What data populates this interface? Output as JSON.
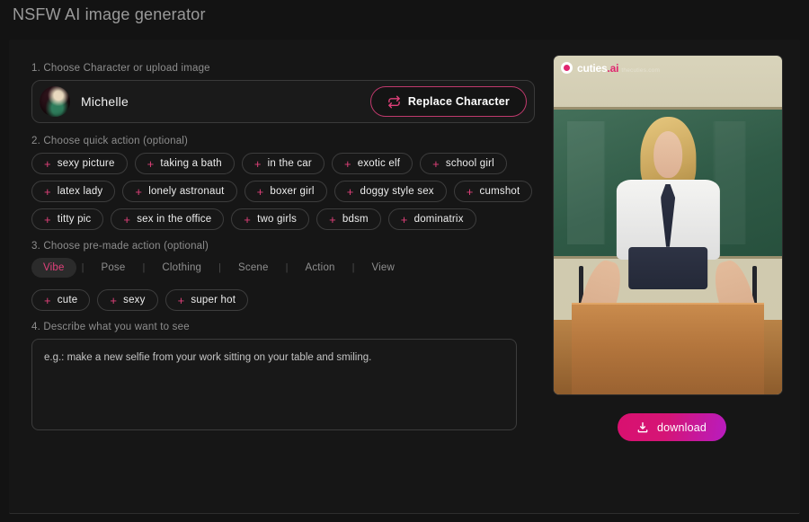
{
  "header": {
    "title": "NSFW AI image generator"
  },
  "steps": {
    "character": "1. Choose Character or upload image",
    "quick_action": "2. Choose quick action (optional)",
    "premade_action": "3. Choose pre-made action (optional)",
    "describe": "4. Describe what you want to see"
  },
  "character": {
    "name": "Michelle",
    "replace_label": "Replace Character",
    "avatar_icon": "character-avatar",
    "swap_icon": "swap-arrows-icon"
  },
  "quick_actions": [
    "sexy picture",
    "taking a bath",
    "in the car",
    "exotic elf",
    "school girl",
    "latex lady",
    "lonely astronaut",
    "boxer girl",
    "doggy style sex",
    "cumshot",
    "titty pic",
    "sex in the office",
    "two girls",
    "bdsm",
    "dominatrix"
  ],
  "premade": {
    "tabs": [
      "Vibe",
      "Pose",
      "Clothing",
      "Scene",
      "Action",
      "View"
    ],
    "active_tab": "Vibe",
    "separator": "|",
    "options": [
      "cute",
      "sexy",
      "super hot"
    ]
  },
  "prompt": {
    "value": "",
    "placeholder": "e.g.: make a new selfie from your work sitting on your table and smiling."
  },
  "preview": {
    "watermark_main": "cuties",
    "watermark_domain": ".ai",
    "watermark_sub": "thecuties.com",
    "watermark_logo_icon": "cuties-logo-icon",
    "download_label": "download",
    "download_icon": "download-icon"
  },
  "chip_plus": "+",
  "colors": {
    "accent_pink": "#e0407a",
    "accent_magenta": "#d9106f",
    "accent_purple": "#b81cc0",
    "page_bg": "#131313",
    "card_bg": "#161616",
    "text_muted": "#8d8d8d"
  }
}
